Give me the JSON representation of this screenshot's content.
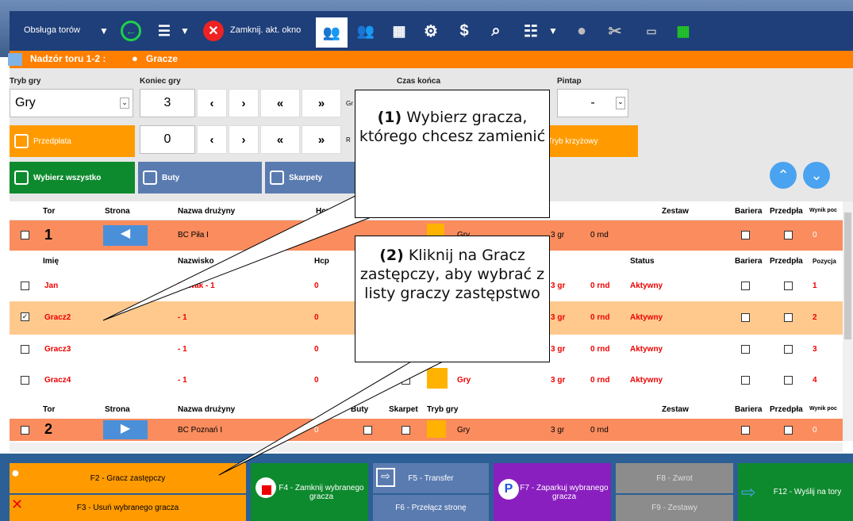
{
  "toolbar": {
    "track_service": "Obsługa torów",
    "close_window": "Zamknij. akt. okno"
  },
  "header": {
    "supervision": "Nadzór toru 1-2 :",
    "players": "Gracze"
  },
  "panel": {
    "game_mode_label": "Tryb gry",
    "game_mode_value": "Gry",
    "game_end_label": "Koniec gry",
    "game_end_value": "3",
    "second_value": "0",
    "end_time_label": "Czas końca",
    "pintap_label": "Pintap",
    "pintap_value": "-",
    "prepaid_label": "Przedpłata",
    "cross_mode_label": "Tryb krzyżowy",
    "select_all_label": "Wybierz wszystko",
    "shoes_label": "Buty",
    "socks_label": "Skarpety",
    "nav_prev": "‹",
    "nav_next": "›",
    "nav_first": "«",
    "nav_last": "»",
    "gr_label": "Gr",
    "r_label": "R"
  },
  "lane_header": {
    "tor": "Tor",
    "strona": "Strona",
    "druzyna": "Nazwa drużyny",
    "hcp": "Hcp",
    "zestaw": "Zestaw",
    "bariera": "Bariera",
    "przedpla": "Przedpła",
    "wynik": "Wynik poc"
  },
  "lane1": {
    "tor": "1",
    "team": "BC Piła I",
    "hcp": "0",
    "mode": "Gry",
    "games": "3 gr",
    "rounds": "0 rnd",
    "score": "0"
  },
  "player_header": {
    "imie": "Imię",
    "nazwisko": "Nazwisko",
    "hcp": "Hcp",
    "status": "Status",
    "bariera": "Bariera",
    "przedpla": "Przedpła",
    "pozycja": "Pozycja"
  },
  "players": [
    {
      "name": "Jan",
      "surname": "Nowak - 1",
      "hcp": "0",
      "games": "3 gr",
      "rounds": "0 rnd",
      "status": "Aktywny",
      "pos": "1"
    },
    {
      "name": "Gracz2",
      "surname": "- 1",
      "hcp": "0",
      "games": "3 gr",
      "rounds": "0 rnd",
      "status": "Aktywny",
      "pos": "2"
    },
    {
      "name": "Gracz3",
      "surname": "- 1",
      "hcp": "0",
      "games": "3 gr",
      "rounds": "0 rnd",
      "status": "Aktywny",
      "pos": "3"
    },
    {
      "name": "Gracz4",
      "surname": "- 1",
      "hcp": "0",
      "mode": "Gry",
      "games": "3 gr",
      "rounds": "0 rnd",
      "status": "Aktywny",
      "pos": "4"
    }
  ],
  "lane2_header": {
    "tor": "Tor",
    "strona": "Strona",
    "druzyna": "Nazwa drużyny",
    "buty": "Buty",
    "skarpet": "Skarpet",
    "tryb": "Tryb gry",
    "zestaw": "Zestaw",
    "bariera": "Bariera",
    "przedpla": "Przedpła",
    "wynik": "Wynik poc"
  },
  "lane2": {
    "tor": "2",
    "team": "BC Poznań I",
    "hcp": "0",
    "mode": "Gry",
    "games": "3 gr",
    "rounds": "0 rnd",
    "score": "0"
  },
  "buttons": {
    "f2": "F2 - Gracz zastępczy",
    "f3": "F3 - Usuń wybranego gracza",
    "f4": "F4 - Zamknij wybranego gracza",
    "f5": "F5 - Transfer",
    "f6": "F6 - Przełącz stronę",
    "f7": "F7 - Zaparkuj wybranego gracza",
    "f8": "F8 - Zwrot",
    "f9": "F9 - Zestawy",
    "f12": "F12 - Wyślij na tory"
  },
  "callouts": {
    "c1_num": "(1)",
    "c1_text": "Wybierz gracza, którego chcesz zamienić",
    "c2_num": "(2)",
    "c2_text": "Kliknij na Gracz zastępczy, aby wybrać z listy graczy zastępstwo"
  },
  "colors": {
    "orange": "#ff9b00",
    "green": "#0e8a2e",
    "purple": "#8a1fc0",
    "gray": "#8c8c8c",
    "blue": "#5a7bb0"
  }
}
